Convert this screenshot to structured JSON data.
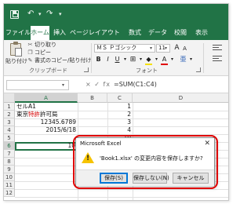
{
  "ribbon_tabs": [
    "ファイル",
    "ホーム",
    "挿入",
    "ページレイアウト",
    "数式",
    "データ",
    "校閲",
    "表示"
  ],
  "active_tab_index": 1,
  "clipboard": {
    "paste_label": "貼り付け",
    "cut": "切り取り",
    "copy": "コピー",
    "format_painter": "書式のコピー/貼り付け",
    "group_label": "クリップボード"
  },
  "font": {
    "name": "ＭＳ Ｐゴシック",
    "size": "11",
    "group_label": "フォント"
  },
  "formula_bar": {
    "fx": "× ✓ fx",
    "formula": "=SUM(C1:C4)"
  },
  "columns": [
    "A",
    "B",
    "C",
    "D"
  ],
  "rows": [
    "1",
    "2",
    "3",
    "4",
    "5",
    "6",
    "7",
    "8",
    "9",
    "10",
    "11",
    "12"
  ],
  "cells": {
    "A1": "セルA1",
    "A2_part1": "東京",
    "A2_part2": "特許",
    "A2_part3": "許可局",
    "A3": "12345.6789",
    "A4": "2015/6/18",
    "A6": "10",
    "C1": "1",
    "C2": "2",
    "C3": "3",
    "C4": "4",
    "C5": "10"
  },
  "dialog": {
    "title": "Microsoft Excel",
    "close": "✕",
    "message": "'Book1.xlsx' の変更内容を保存しますか?",
    "save_button": "保存(S)",
    "dont_save_button": "保存しない(N)",
    "cancel_button": "キャンセル"
  },
  "colors": {
    "excel_green": "#217346",
    "highlight_red": "#d40000",
    "annotation_red": "#e00000"
  }
}
